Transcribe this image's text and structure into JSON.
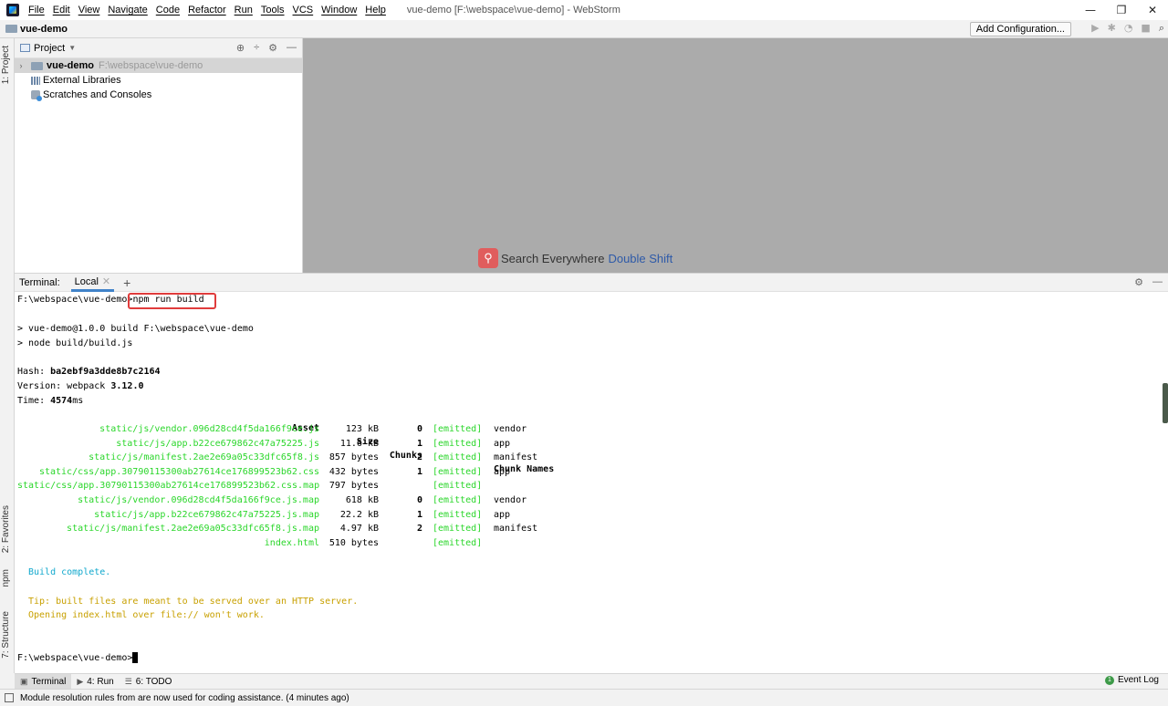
{
  "titlebar": {
    "menu": [
      "File",
      "Edit",
      "View",
      "Navigate",
      "Code",
      "Refactor",
      "Run",
      "Tools",
      "VCS",
      "Window",
      "Help"
    ],
    "window_title": "vue-demo [F:\\webspace\\vue-demo] - WebStorm",
    "controls": [
      "—",
      "❐",
      "✕"
    ]
  },
  "navbar": {
    "project_name": "vue-demo",
    "add_configuration": "Add Configuration..."
  },
  "left_strip": {
    "tabs": [
      "1: Project",
      "2: Favorites",
      "npm",
      "7: Structure"
    ]
  },
  "project_panel": {
    "title": "Project",
    "tree": [
      {
        "label": "vue-demo",
        "path": "F:\\webspace\\vue-demo"
      },
      {
        "label": "External Libraries"
      },
      {
        "label": "Scratches and Consoles"
      }
    ]
  },
  "editor": {
    "search_label": "Search Everywhere",
    "search_shortcut": "Double Shift"
  },
  "terminal": {
    "label": "Terminal:",
    "tab_name": "Local",
    "prompt": "F:\\webspace\\vue-demo>",
    "command": "npm run build",
    "lines": {
      "run_line": "> vue-demo@1.0.0 build F:\\webspace\\vue-demo",
      "node_line": "> node build/build.js",
      "hash_label": "Hash: ",
      "hash_value": "ba2ebf9a3dde8b7c2164",
      "version_label": "Version: webpack ",
      "version_value": "3.12.0",
      "time_label": "Time: ",
      "time_value": "4574",
      "time_unit": "ms"
    },
    "table_headers": {
      "asset": "Asset",
      "size": "Size",
      "chunks": "Chunks",
      "chunk_names": "Chunk Names"
    },
    "assets": [
      {
        "asset": "static/js/vendor.096d28cd4f5da166f9ce.js",
        "size": "123 kB",
        "chunks": "0",
        "emitted": "[emitted]",
        "name": "vendor"
      },
      {
        "asset": "static/js/app.b22ce679862c47a75225.js",
        "size": "11.6 kB",
        "chunks": "1",
        "emitted": "[emitted]",
        "name": "app"
      },
      {
        "asset": "static/js/manifest.2ae2e69a05c33dfc65f8.js",
        "size": "857 bytes",
        "chunks": "2",
        "emitted": "[emitted]",
        "name": "manifest"
      },
      {
        "asset": "static/css/app.30790115300ab27614ce176899523b62.css",
        "size": "432 bytes",
        "chunks": "1",
        "emitted": "[emitted]",
        "name": "app"
      },
      {
        "asset": "static/css/app.30790115300ab27614ce176899523b62.css.map",
        "size": "797 bytes",
        "chunks": "",
        "emitted": "[emitted]",
        "name": ""
      },
      {
        "asset": "static/js/vendor.096d28cd4f5da166f9ce.js.map",
        "size": "618 kB",
        "chunks": "0",
        "emitted": "[emitted]",
        "name": "vendor"
      },
      {
        "asset": "static/js/app.b22ce679862c47a75225.js.map",
        "size": "22.2 kB",
        "chunks": "1",
        "emitted": "[emitted]",
        "name": "app"
      },
      {
        "asset": "static/js/manifest.2ae2e69a05c33dfc65f8.js.map",
        "size": "4.97 kB",
        "chunks": "2",
        "emitted": "[emitted]",
        "name": "manifest"
      },
      {
        "asset": "index.html",
        "size": "510 bytes",
        "chunks": "",
        "emitted": "[emitted]",
        "name": ""
      }
    ],
    "build_complete": "Build complete.",
    "tip_line1": "Tip: built files are meant to be served over an HTTP server.",
    "tip_line2": "Opening index.html over file:// won't work.",
    "final_prompt": "F:\\webspace\\vue-demo>"
  },
  "bottom_tabs": {
    "terminal": "Terminal",
    "run": "4: Run",
    "todo": "6: TODO",
    "event_log": "Event Log"
  },
  "status": {
    "message": "Module resolution rules from  are now used for coding assistance. (4 minutes ago)"
  },
  "colors": {
    "emitted_green": "#2ad62a",
    "build_cyan": "#11a8cd",
    "tip_yellow": "#c8a000",
    "highlight_red": "#e03c3c",
    "editor_bg": "#ababab"
  }
}
